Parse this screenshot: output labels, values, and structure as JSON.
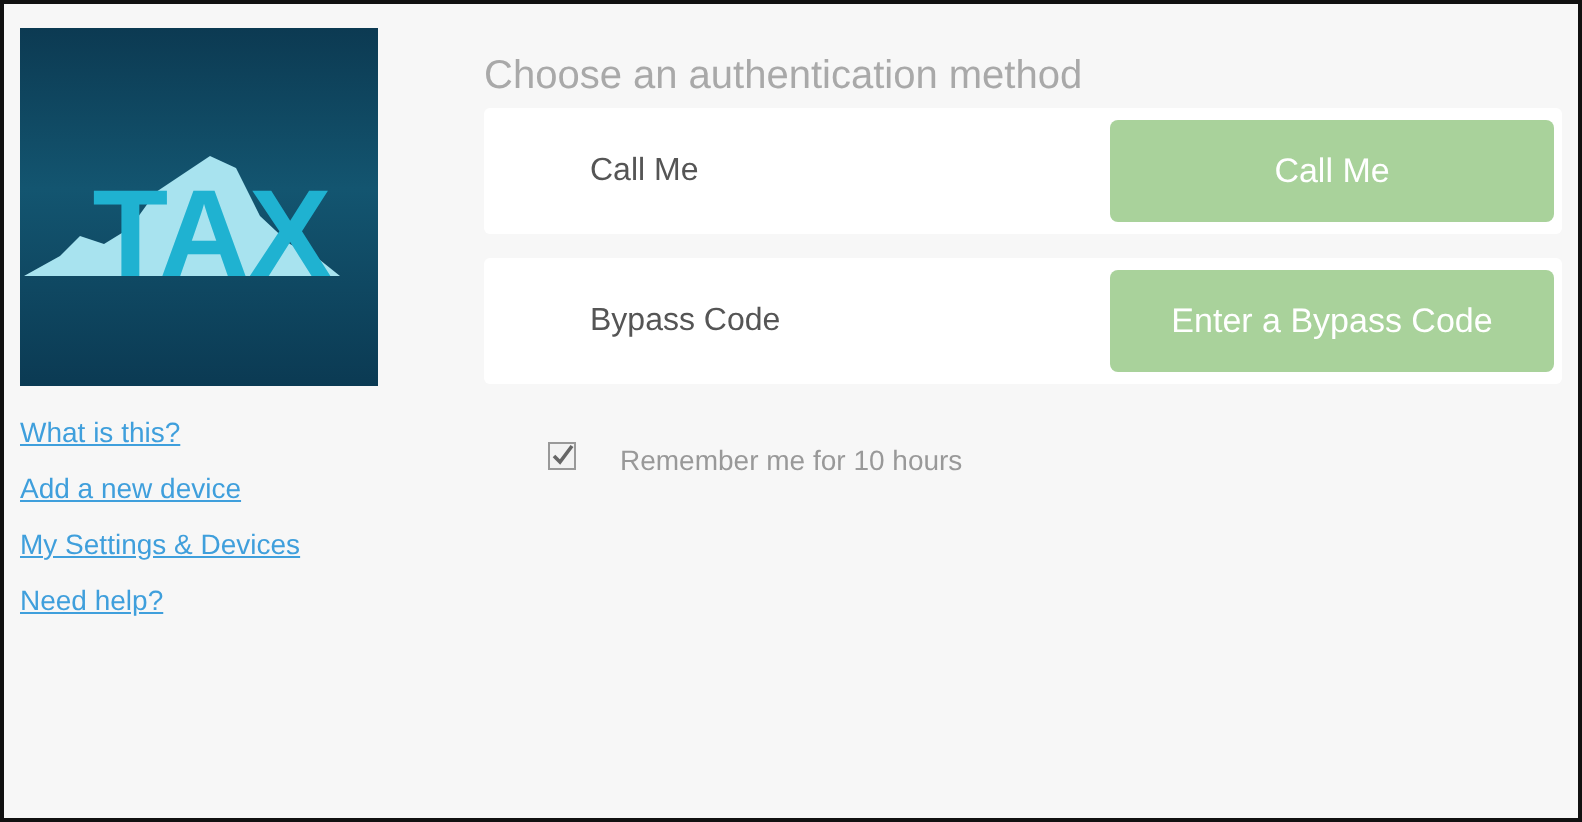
{
  "logo": {
    "text": "TAX"
  },
  "links": [
    "What is this?",
    "Add a new device",
    "My Settings & Devices",
    "Need help?"
  ],
  "heading": "Choose an authentication method",
  "methods": [
    {
      "label": "Call Me",
      "button": "Call Me",
      "disabled": true
    },
    {
      "label": "Bypass Code",
      "button": "Enter a Bypass Code",
      "disabled": true
    }
  ],
  "remember": {
    "label": "Remember me for 10 hours",
    "checked": true
  }
}
